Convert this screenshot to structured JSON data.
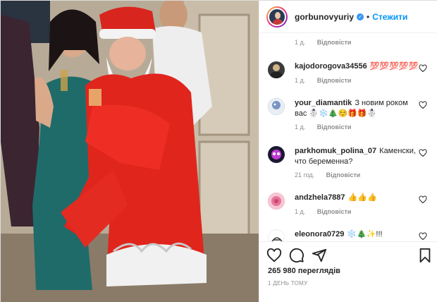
{
  "post": {
    "username": "gorbunovyuriy",
    "separator": "•",
    "follow_label": "Стежити",
    "verified_icon": "verified-badge-icon"
  },
  "comments_top_meta": {
    "time": "1 д.",
    "reply_label": "Відповісти"
  },
  "comments": [
    {
      "username": "kajodorogova34556",
      "text": "💯💯💯💯💯",
      "time": "1 д.",
      "reply_label": "Відповісти",
      "avatar_color": "#3b3b3b"
    },
    {
      "username": "your_diamantik",
      "text": "З новим роком вас ☃️❄️🎄☺️🎁🎁☃️",
      "time": "1 д.",
      "reply_label": "Відповісти",
      "avatar_color": "#5a7fb0"
    },
    {
      "username": "parkhomuk_polina_07",
      "text": "Каменски, что беременна?",
      "time": "21 год.",
      "reply_label": "Відповісти",
      "avatar_color": "#7b4fd6"
    },
    {
      "username": "andzhela7887",
      "text": "👍👍👍",
      "time": "1 д.",
      "reply_label": "Відповісти",
      "avatar_color": "#e8739a"
    },
    {
      "username": "eleonora0729",
      "text": "❄️🎄✨!!!",
      "time": "",
      "reply_label": "",
      "avatar_color": "#ffffff"
    }
  ],
  "actions": {
    "like_icon": "heart-icon",
    "comment_icon": "comment-icon",
    "share_icon": "share-icon",
    "save_icon": "bookmark-icon"
  },
  "stats": {
    "views": "265 980 переглядів",
    "date": "1 ДЕНЬ ТОМУ"
  },
  "colors": {
    "link_blue": "#0095f6",
    "muted_gray": "#8e8e8e",
    "text_dark": "#262626"
  }
}
